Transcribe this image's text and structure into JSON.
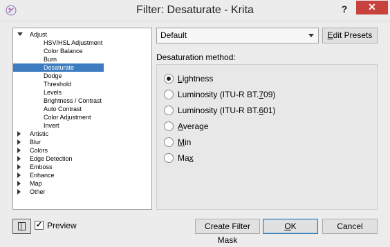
{
  "window": {
    "title": "Filter: Desaturate - Krita",
    "help_label": "?",
    "close_label": "✕"
  },
  "tree": {
    "items": [
      {
        "label": "Adjust",
        "level": 0,
        "expanded": true
      },
      {
        "label": "HSV/HSL Adjustment",
        "level": 1
      },
      {
        "label": "Color Balance",
        "level": 1
      },
      {
        "label": "Burn",
        "level": 1
      },
      {
        "label": "Desaturate",
        "level": 1,
        "selected": true
      },
      {
        "label": "Dodge",
        "level": 1
      },
      {
        "label": "Threshold",
        "level": 1
      },
      {
        "label": "Levels",
        "level": 1
      },
      {
        "label": "Brightness / Contrast",
        "level": 1
      },
      {
        "label": "Auto Contrast",
        "level": 1
      },
      {
        "label": "Color Adjustment",
        "level": 1
      },
      {
        "label": "Invert",
        "level": 1
      },
      {
        "label": "Artistic",
        "level": 0,
        "expanded": false
      },
      {
        "label": "Blur",
        "level": 0,
        "expanded": false
      },
      {
        "label": "Colors",
        "level": 0,
        "expanded": false
      },
      {
        "label": "Edge Detection",
        "level": 0,
        "expanded": false
      },
      {
        "label": "Emboss",
        "level": 0,
        "expanded": false
      },
      {
        "label": "Enhance",
        "level": 0,
        "expanded": false
      },
      {
        "label": "Map",
        "level": 0,
        "expanded": false
      },
      {
        "label": "Other",
        "level": 0,
        "expanded": false
      }
    ]
  },
  "presets": {
    "selected": "Default",
    "edit_label_prefix": "",
    "edit_label_mnemonic": "E",
    "edit_label_rest": "dit Presets"
  },
  "method": {
    "label": "Desaturation method:",
    "options": [
      {
        "pre": "",
        "mn": "L",
        "post": "ightness",
        "checked": true
      },
      {
        "pre": "Luminosity (ITU-R BT.",
        "mn": "7",
        "post": "09)",
        "checked": false
      },
      {
        "pre": "Luminosity (ITU-R BT.",
        "mn": "6",
        "post": "01)",
        "checked": false
      },
      {
        "pre": "",
        "mn": "A",
        "post": "verage",
        "checked": false
      },
      {
        "pre": "",
        "mn": "M",
        "post": "in",
        "checked": false
      },
      {
        "pre": "Ma",
        "mn": "x",
        "post": "",
        "checked": false
      }
    ]
  },
  "footer": {
    "preview_checked_mark": "✓",
    "preview_label": "Preview",
    "create_mask_label": "Create Filter Mask",
    "ok_pre": "",
    "ok_mn": "O",
    "ok_post": "K",
    "cancel_label": "Cancel"
  },
  "colors": {
    "selection": "#3d7cc0",
    "close_button": "#c7423c"
  }
}
